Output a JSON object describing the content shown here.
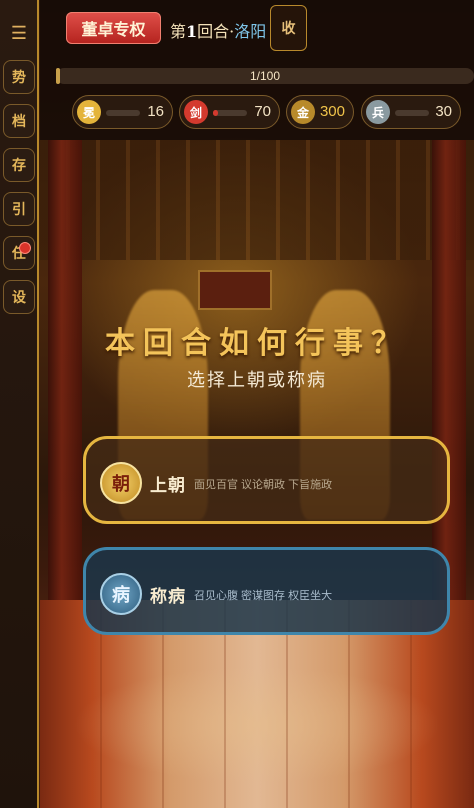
{
  "sidebar": {
    "menu_icon": "☰",
    "items": [
      {
        "label": "势"
      },
      {
        "label": "档"
      },
      {
        "label": "存"
      },
      {
        "label": "引"
      },
      {
        "label": "任",
        "has_notification": true
      },
      {
        "label": "设"
      }
    ]
  },
  "header": {
    "badge": "董卓专权",
    "round_prefix": "第",
    "round_number": "1",
    "round_suffix": "回合·",
    "city": "洛阳",
    "collect_label": "收",
    "progress_text": "1/100",
    "progress_fraction": 0.01
  },
  "stats": [
    {
      "icon": "冕",
      "value": "16",
      "color": "#e4b43a",
      "fill_fraction": 0.0
    },
    {
      "icon": "剑",
      "value": "70",
      "color": "#d43a2e",
      "fill_fraction": 0.15
    },
    {
      "icon": "金",
      "value": "300",
      "color": "#b88a2a",
      "fill_fraction": null
    },
    {
      "icon": "兵",
      "value": "30",
      "color": "#8a9aa0",
      "fill_fraction": 0.0
    }
  ],
  "prompt": {
    "question": "本回合如何行事？",
    "subtitle": "选择上朝或称病"
  },
  "options": [
    {
      "seal": "朝",
      "label": "上朝",
      "desc": "面见百官 议论朝政 下旨施政",
      "accent": "#e6b640"
    },
    {
      "seal": "病",
      "label": "称病",
      "desc": "召见心腹 密谋图存 权臣坐大",
      "accent": "#3f86ab"
    }
  ]
}
